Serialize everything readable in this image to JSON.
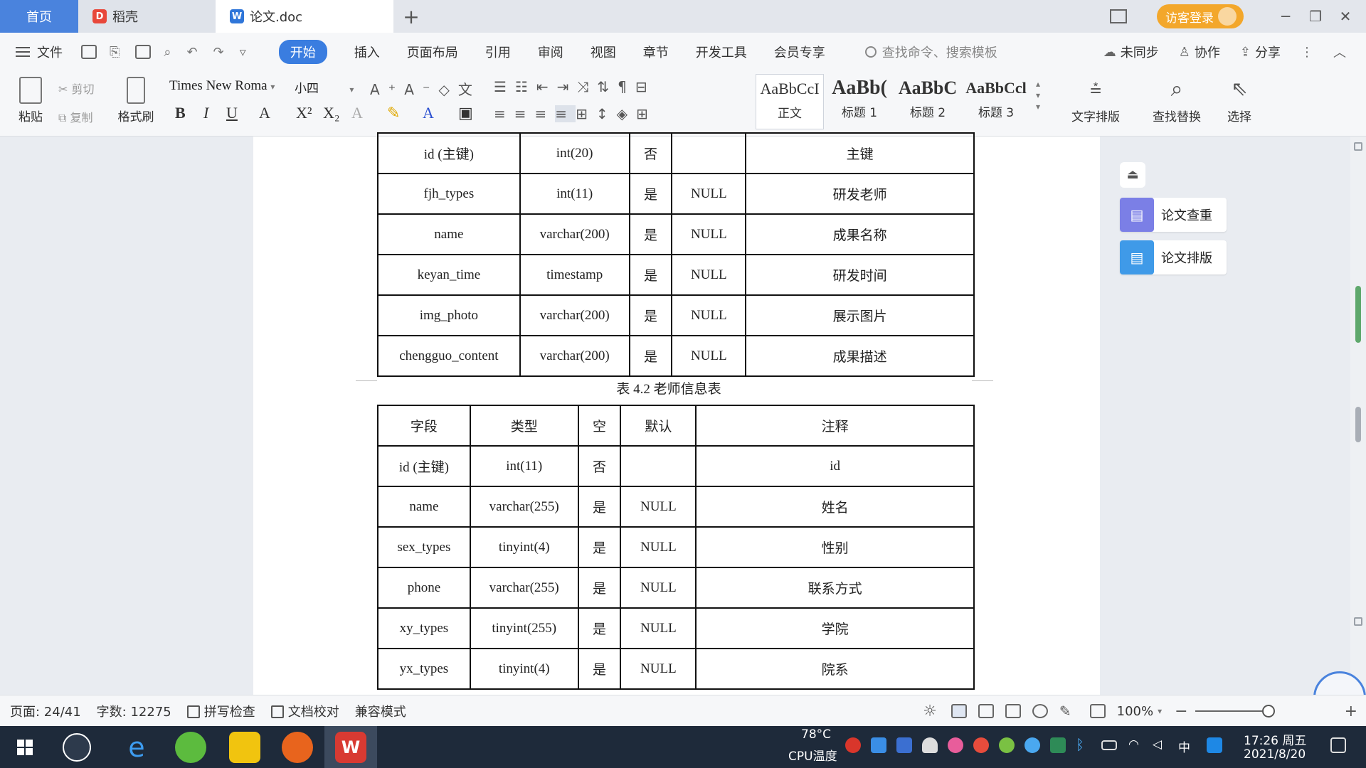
{
  "tabs": {
    "home": "首页",
    "daoke": "稻壳",
    "doc": "论文.doc"
  },
  "titlebar": {
    "login": "访客登录"
  },
  "menu": {
    "file": "文件",
    "items": [
      "开始",
      "插入",
      "页面布局",
      "引用",
      "审阅",
      "视图",
      "章节",
      "开发工具",
      "会员专享"
    ],
    "search_placeholder": "查找命令、搜索模板",
    "sync": "未同步",
    "collab": "协作",
    "share": "分享"
  },
  "ribbon": {
    "paste": "粘贴",
    "cut": "剪切",
    "copy": "复制",
    "format_painter": "格式刷",
    "font_name": "Times New Roma",
    "font_size": "小四",
    "styles": [
      {
        "sample": "AaBbCcI",
        "name": "正文"
      },
      {
        "sample": "AaBb(",
        "name": "标题 1"
      },
      {
        "sample": "AaBbC",
        "name": "标题 2"
      },
      {
        "sample": "AaBbCcl",
        "name": "标题 3"
      }
    ],
    "text_layout": "文字排版",
    "find_replace": "查找替换",
    "select": "选择"
  },
  "table1": {
    "rows": [
      [
        "id (主键)",
        "int(20)",
        "否",
        "",
        "主键"
      ],
      [
        "fjh_types",
        "int(11)",
        "是",
        "NULL",
        "研发老师"
      ],
      [
        "name",
        "varchar(200)",
        "是",
        "NULL",
        "成果名称"
      ],
      [
        "keyan_time",
        "timestamp",
        "是",
        "NULL",
        "研发时间"
      ],
      [
        "img_photo",
        "varchar(200)",
        "是",
        "NULL",
        "展示图片"
      ],
      [
        "chengguo_content",
        "varchar(200)",
        "是",
        "NULL",
        "成果描述"
      ]
    ]
  },
  "caption": "表 4.2  老师信息表",
  "table2": {
    "header": [
      "字段",
      "类型",
      "空",
      "默认",
      "注释"
    ],
    "rows": [
      [
        "id (主键)",
        "int(11)",
        "否",
        "",
        "id"
      ],
      [
        "name",
        "varchar(255)",
        "是",
        "NULL",
        "姓名"
      ],
      [
        "sex_types",
        "tinyint(4)",
        "是",
        "NULL",
        "性别"
      ],
      [
        "phone",
        "varchar(255)",
        "是",
        "NULL",
        "联系方式"
      ],
      [
        "xy_types",
        "tinyint(255)",
        "是",
        "NULL",
        "学院"
      ],
      [
        "yx_types",
        "tinyint(4)",
        "是",
        "NULL",
        "院系"
      ]
    ]
  },
  "right_panel": {
    "check": "论文查重",
    "layout": "论文排版"
  },
  "status": {
    "page": "页面: 24/41",
    "words": "字数: 12275",
    "spell": "拼写检查",
    "proof": "文档校对",
    "compat": "兼容模式",
    "zoom": "100%"
  },
  "taskbar": {
    "temp": "78°C",
    "cpu": "CPU温度",
    "ime": "中",
    "time": "17:26 周五",
    "date": "2021/8/20"
  }
}
